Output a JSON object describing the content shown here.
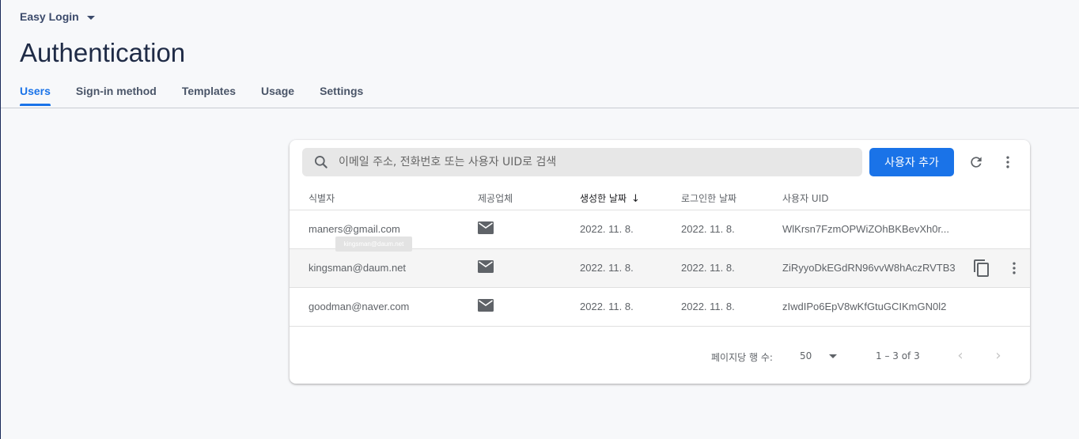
{
  "project": {
    "name": "Easy Login",
    "dropdown_icon": "caret-down-icon"
  },
  "page": {
    "title": "Authentication"
  },
  "tabs": [
    {
      "label": "Users",
      "active": true
    },
    {
      "label": "Sign-in method"
    },
    {
      "label": "Templates"
    },
    {
      "label": "Usage"
    },
    {
      "label": "Settings"
    }
  ],
  "toolbar": {
    "search_placeholder": "이메일 주소, 전화번호 또는 사용자 UID로 검색",
    "add_user_label": "사용자 추가",
    "icons": [
      "search-icon",
      "refresh-icon",
      "more-vert-icon"
    ],
    "accent_color": "#1a73e8"
  },
  "table": {
    "columns": [
      "식별자",
      "제공업체",
      "생성한 날짜",
      "로그인한 날짜",
      "사용자 UID"
    ],
    "sorted_column": "생성한 날짜",
    "sort_direction": "descending",
    "rows": [
      {
        "identifier": "maners@gmail.com",
        "provider_icon": "mail-icon",
        "created": "2022. 11. 8.",
        "signed_in": "2022. 11. 8.",
        "uid": "WlKrsn7FzmOPWiZOhBKBevXh0r..."
      },
      {
        "identifier": "kingsman@daum.net",
        "provider_icon": "mail-icon",
        "created": "2022. 11. 8.",
        "signed_in": "2022. 11. 8.",
        "uid": "ZiRyyoDkEGdRN96vvW8hAczRVTB3"
      },
      {
        "identifier": "goodman@naver.com",
        "provider_icon": "mail-icon",
        "created": "2022. 11. 8.",
        "signed_in": "2022. 11. 8.",
        "uid": "zIwdIPo6EpV8wKfGtuGCIKmGN0l2"
      }
    ],
    "tooltip": "kingsman@daum.net"
  },
  "pagination": {
    "rows_per_page_label": "페이지당 행 수:",
    "rows_per_page": "50",
    "range": "1 – 3 of 3"
  }
}
